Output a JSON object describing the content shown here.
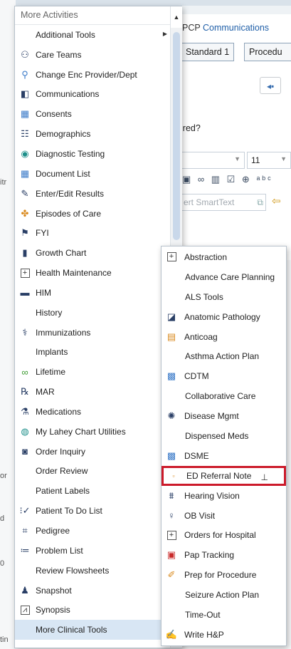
{
  "background": {
    "nav_prefix": "PCP",
    "nav_link": "Communications",
    "tabs": [
      "Standard 1",
      "Procedu"
    ],
    "question_fragment": "ired?",
    "font_size_value": "11",
    "smarttext_placeholder": "ert SmartText",
    "left_edge_fragments": [
      "itr",
      "or",
      "d",
      "0",
      "tin"
    ]
  },
  "main_menu": {
    "header": "More Activities",
    "items": [
      {
        "label": "Additional Tools",
        "icon": null,
        "submenu": true
      },
      {
        "label": "Care Teams",
        "icon": "people-icon"
      },
      {
        "label": "Change Enc Provider/Dept",
        "icon": "provider-change-icon"
      },
      {
        "label": "Communications",
        "icon": "communications-icon"
      },
      {
        "label": "Consents",
        "icon": "consents-icon"
      },
      {
        "label": "Demographics",
        "icon": "demographics-icon"
      },
      {
        "label": "Diagnostic Testing",
        "icon": "diagnostic-icon"
      },
      {
        "label": "Document List",
        "icon": "document-list-icon"
      },
      {
        "label": "Enter/Edit Results",
        "icon": "pencil-icon"
      },
      {
        "label": "Episodes of Care",
        "icon": "episodes-icon"
      },
      {
        "label": "FYI",
        "icon": "fyi-flag-icon"
      },
      {
        "label": "Growth Chart",
        "icon": "growth-chart-icon"
      },
      {
        "label": "Health Maintenance",
        "icon": "plus-box-icon"
      },
      {
        "label": "HIM",
        "icon": "him-icon",
        "submenu": true
      },
      {
        "label": "History",
        "icon": null
      },
      {
        "label": "Immunizations",
        "icon": "syringe-icon"
      },
      {
        "label": "Implants",
        "icon": null
      },
      {
        "label": "Lifetime",
        "icon": "lifetime-icon"
      },
      {
        "label": "MAR",
        "icon": "mar-icon"
      },
      {
        "label": "Medications",
        "icon": "medications-icon"
      },
      {
        "label": "My Lahey Chart Utilities",
        "icon": "globe-icon",
        "submenu": true
      },
      {
        "label": "Order Inquiry",
        "icon": "order-inquiry-icon"
      },
      {
        "label": "Order Review",
        "icon": null
      },
      {
        "label": "Patient Labels",
        "icon": null
      },
      {
        "label": "Patient To Do List",
        "icon": "todo-icon"
      },
      {
        "label": "Pedigree",
        "icon": "pedigree-icon"
      },
      {
        "label": "Problem List",
        "icon": "problem-list-icon"
      },
      {
        "label": "Review Flowsheets",
        "icon": null
      },
      {
        "label": "Snapshot",
        "icon": "snapshot-icon"
      },
      {
        "label": "Synopsis",
        "icon": "synopsis-icon"
      },
      {
        "label": "More Clinical Tools",
        "icon": null,
        "submenu": true,
        "highlighted": true
      }
    ]
  },
  "sub_menu": {
    "items": [
      {
        "label": "Abstraction",
        "icon": "plus-box-icon"
      },
      {
        "label": "Advance Care Planning",
        "icon": null
      },
      {
        "label": "ALS Tools",
        "icon": null
      },
      {
        "label": "Anatomic Pathology",
        "icon": "pathology-icon"
      },
      {
        "label": "Anticoag",
        "icon": "clipboard-icon"
      },
      {
        "label": "Asthma Action Plan",
        "icon": null
      },
      {
        "label": "CDTM",
        "icon": "chart-icon"
      },
      {
        "label": "Collaborative Care",
        "icon": null
      },
      {
        "label": "Disease Mgmt",
        "icon": "disease-mgmt-icon"
      },
      {
        "label": "Dispensed Meds",
        "icon": null
      },
      {
        "label": "DSME",
        "icon": "chart-icon"
      },
      {
        "label": "ED Referral Note",
        "icon": "note-icon",
        "selected": true,
        "pinned": true
      },
      {
        "label": "Hearing Vision",
        "icon": "binoculars-icon"
      },
      {
        "label": "OB Visit",
        "icon": "ob-visit-icon"
      },
      {
        "label": "Orders for Hospital",
        "icon": "plus-box-icon"
      },
      {
        "label": "Pap Tracking",
        "icon": "pap-tracking-icon"
      },
      {
        "label": "Prep for Procedure",
        "icon": "prep-icon"
      },
      {
        "label": "Seizure Action Plan",
        "icon": null
      },
      {
        "label": "Time-Out",
        "icon": null
      },
      {
        "label": "Write H&P",
        "icon": "write-icon"
      }
    ]
  }
}
